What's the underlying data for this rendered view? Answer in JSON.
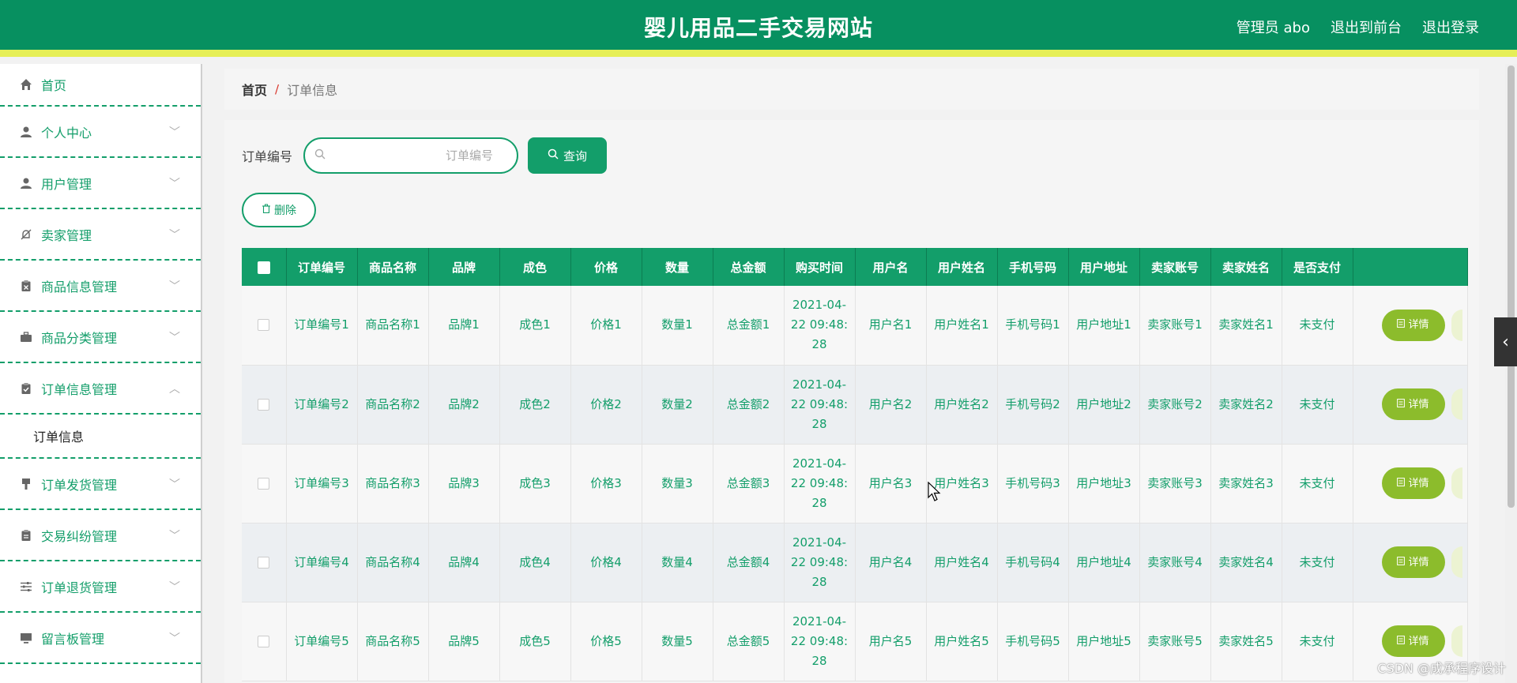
{
  "header": {
    "title": "婴儿用品二手交易网站",
    "admin": "管理员 abo",
    "back_front": "退出到前台",
    "logout": "退出登录"
  },
  "sidebar": {
    "items": [
      {
        "label": "首页",
        "icon": "home-icon"
      },
      {
        "label": "个人中心",
        "icon": "person-icon"
      },
      {
        "label": "用户管理",
        "icon": "user-icon"
      },
      {
        "label": "卖家管理",
        "icon": "bell-off-icon"
      },
      {
        "label": "商品信息管理",
        "icon": "clipboard-icon"
      },
      {
        "label": "商品分类管理",
        "icon": "briefcase-icon"
      },
      {
        "label": "订单信息管理",
        "icon": "checklist-icon"
      },
      {
        "label": "订单发货管理",
        "icon": "brush-icon"
      },
      {
        "label": "交易纠纷管理",
        "icon": "document-icon"
      },
      {
        "label": "订单退货管理",
        "icon": "sliders-icon"
      },
      {
        "label": "留言板管理",
        "icon": "monitor-icon"
      }
    ],
    "submenu_label": "订单信息"
  },
  "breadcrumb": {
    "home": "首页",
    "separator": "/",
    "current": "订单信息"
  },
  "search": {
    "label": "订单编号",
    "placeholder": "订单编号",
    "value": "",
    "button_label": "查询"
  },
  "delete_label": "删除",
  "table": {
    "headers": [
      "订单编号",
      "商品名称",
      "品牌",
      "成色",
      "价格",
      "数量",
      "总金额",
      "购买时间",
      "用户名",
      "用户姓名",
      "手机号码",
      "用户地址",
      "卖家账号",
      "卖家姓名",
      "是否支付"
    ],
    "detail_label": "详情",
    "rows": [
      [
        "订单编号1",
        "商品名称1",
        "品牌1",
        "成色1",
        "价格1",
        "数量1",
        "总金额1",
        "2021-04-22 09:48:28",
        "用户名1",
        "用户姓名1",
        "手机号码1",
        "用户地址1",
        "卖家账号1",
        "卖家姓名1",
        "未支付"
      ],
      [
        "订单编号2",
        "商品名称2",
        "品牌2",
        "成色2",
        "价格2",
        "数量2",
        "总金额2",
        "2021-04-22 09:48:28",
        "用户名2",
        "用户姓名2",
        "手机号码2",
        "用户地址2",
        "卖家账号2",
        "卖家姓名2",
        "未支付"
      ],
      [
        "订单编号3",
        "商品名称3",
        "品牌3",
        "成色3",
        "价格3",
        "数量3",
        "总金额3",
        "2021-04-22 09:48:28",
        "用户名3",
        "用户姓名3",
        "手机号码3",
        "用户地址3",
        "卖家账号3",
        "卖家姓名3",
        "未支付"
      ],
      [
        "订单编号4",
        "商品名称4",
        "品牌4",
        "成色4",
        "价格4",
        "数量4",
        "总金额4",
        "2021-04-22 09:48:28",
        "用户名4",
        "用户姓名4",
        "手机号码4",
        "用户地址4",
        "卖家账号4",
        "卖家姓名4",
        "未支付"
      ],
      [
        "订单编号5",
        "商品名称5",
        "品牌5",
        "成色5",
        "价格5",
        "数量5",
        "总金额5",
        "2021-04-22 09:48:28",
        "用户名5",
        "用户姓名5",
        "手机号码5",
        "用户地址5",
        "卖家账号5",
        "卖家姓名5",
        "未支付"
      ]
    ]
  },
  "watermark": "CSDN @成承程序设计",
  "colors": {
    "primary": "#139e6a",
    "header": "#079060",
    "accent_bar": "#e6ef57",
    "detail_button": "#8cbc2c"
  }
}
